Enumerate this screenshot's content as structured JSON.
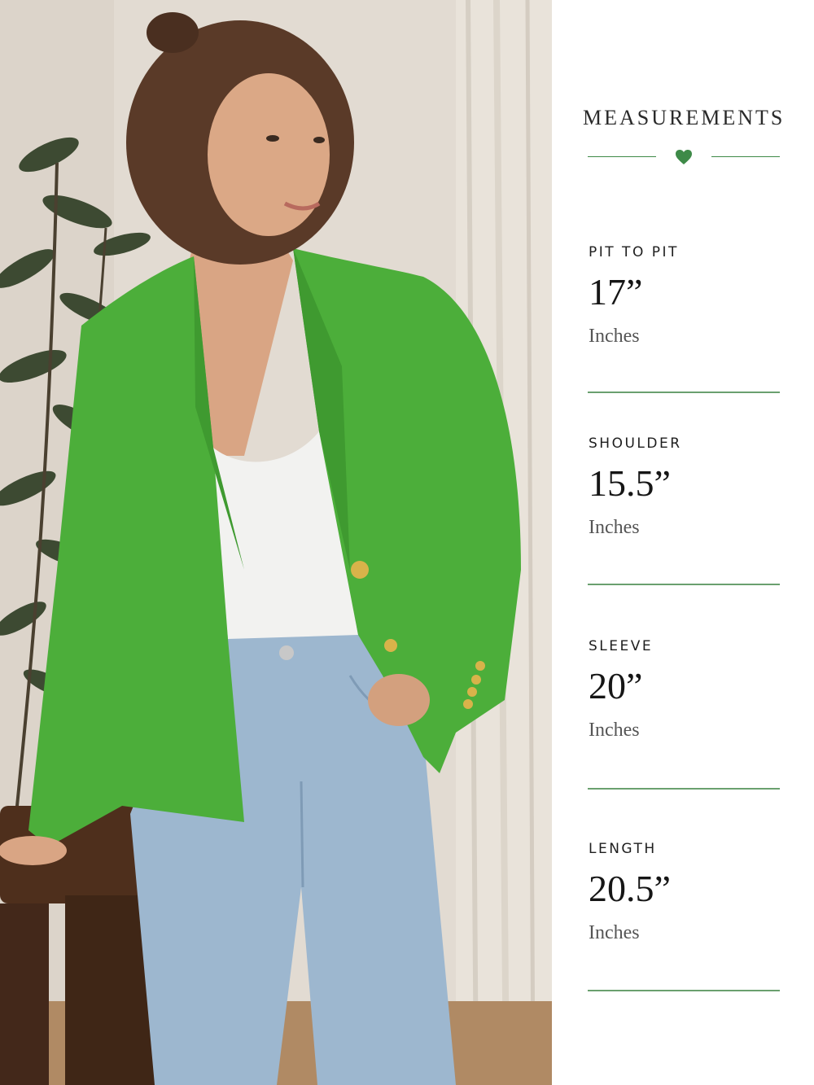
{
  "panel": {
    "title": "MEASUREMENTS",
    "accent_color": "#3e8a48",
    "ornament_icon": "heart-icon",
    "measurements": [
      {
        "label": "PIT TO PIT",
        "value": "17”",
        "unit": "Inches"
      },
      {
        "label": "SHOULDER",
        "value": "15.5”",
        "unit": "Inches"
      },
      {
        "label": "SLEEVE",
        "value": "20”",
        "unit": "Inches"
      },
      {
        "label": "LENGTH",
        "value": "20.5”",
        "unit": "Inches"
      }
    ]
  },
  "photo": {
    "garment_color": "#4cae3a"
  }
}
